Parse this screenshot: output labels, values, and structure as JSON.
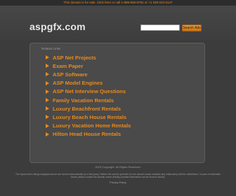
{
  "top_banner": "This domain is for sale. Click here or call 1-888-836-8791 or +1 339-222-5147",
  "header": {
    "logo": "aspgfx.com",
    "search_button": "Search Ads"
  },
  "panel": {
    "heading": "Related Links",
    "links": [
      "ASP Net Projects",
      "Exam Paper",
      "ASP Software",
      "ASP Model Engines",
      "ASP Net Interview Questions",
      "Family Vacation Rentals",
      "Luxury Beachfront Rentals",
      "Luxury Beach House Rentals",
      "Luxury Vacation Home Rentals",
      "Hilton Head House Rentals"
    ]
  },
  "footer": {
    "copyright": "2023 Copyright. All Rights Reserved.",
    "disclaimer": "The Sponsored Listings displayed above are served automatically by a third party. Neither the service provider nor the domain owner maintain any relationship with the advertisers. In case of trademark issues please contact the domain owner directly (contact information can be found in whois).",
    "privacy": "Privacy Policy"
  },
  "colors": {
    "accent": "#e98a1d",
    "background": "#3c3c3c",
    "panel": "#4a4a4a"
  }
}
